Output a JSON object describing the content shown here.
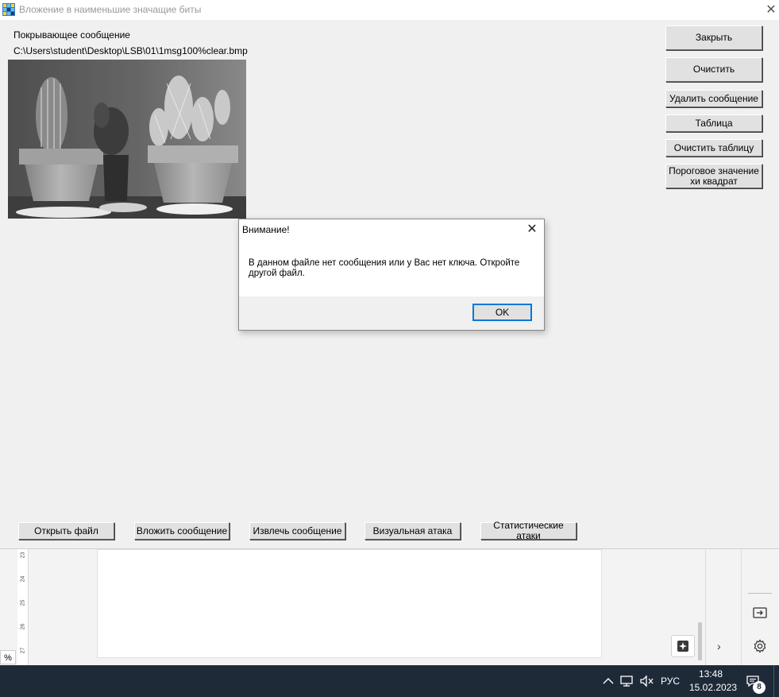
{
  "window": {
    "title": "Вложение в наименьшие значащие биты",
    "close_glyph": "✕"
  },
  "cover": {
    "label": "Покрывающее сообщение",
    "path": "C:\\Users\\student\\Desktop\\LSB\\01\\1msg100%clear.bmp"
  },
  "right_buttons": {
    "close": "Закрыть",
    "clear": "Очистить",
    "delete_message": "Удалить сообщение",
    "table": "Таблица",
    "clear_table": "Очистить таблицу",
    "threshold_line1": "Пороговое значение",
    "threshold_line2": "хи квадрат"
  },
  "bottom_buttons": {
    "open_file": "Открыть файл",
    "embed_message": "Вложить сообщение",
    "extract_message": "Извлечь сообщение",
    "visual_attack": "Визуальная атака",
    "statistical_attacks": "Статистические атаки"
  },
  "dialog": {
    "title": "Внимание!",
    "close_glyph": "✕",
    "message": "В данном файле нет сообщения или у Вас нет ключа. Откройте другой файл.",
    "ok": "OK"
  },
  "editor": {
    "ruler": [
      "23",
      "24",
      "25",
      "26",
      "27"
    ],
    "zoom_suffix": "%",
    "chevron": "›"
  },
  "taskbar": {
    "language": "РУС",
    "time": "13:48",
    "date": "15.02.2023",
    "notification_count": "8"
  }
}
